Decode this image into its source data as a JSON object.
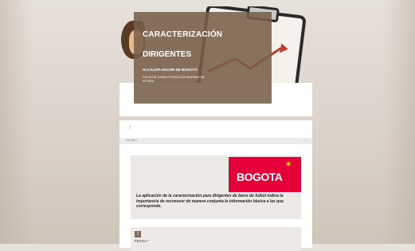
{
  "header": {
    "title_line1": "CARACTERIZACIÓN",
    "title_line2": "DIRIGENTES",
    "organization": "ALCALDÍA MAYOR DE BOGOTÁ",
    "subtitle": "FICHA DE CARACTERIZACIÓN BARRAS DE FÚTBOL"
  },
  "section": {
    "label": "Sección 1",
    "logo_text": "BOGOTA",
    "intro_text": "La aplicación de la caracterización para dirigentes de barra de futbol indica la importancia de reconocer de manera conjunta la información básica a las que corresponde.",
    "field_number": "1",
    "field_label": "FECHA *"
  },
  "colors": {
    "header_panel": "#78604a",
    "logo_bg": "#e6003a",
    "logo_star": "#f7d417"
  }
}
